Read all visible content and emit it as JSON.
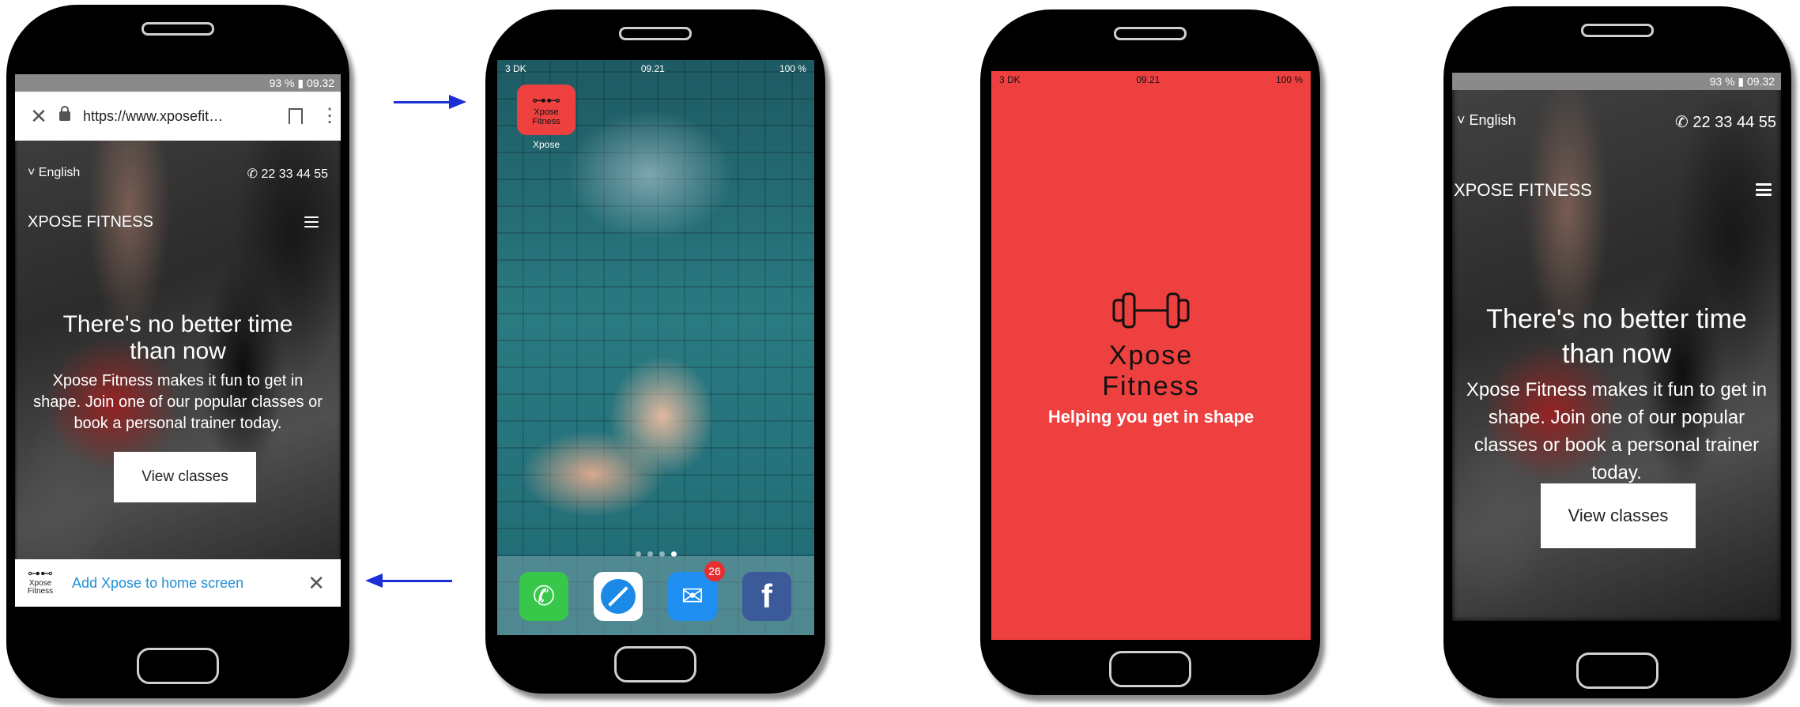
{
  "phone1": {
    "status": "93 % ▮ 09.32",
    "url": "https://www.xposefit…",
    "language": "English",
    "phone": "22 33 44 55",
    "brand": "XPOSE FITNESS",
    "headline": "There's no better time than now",
    "subtext": "Xpose Fitness makes it fun to get in shape. Join one of our popular classes or book a personal trainer today.",
    "cta": "View classes",
    "install_text": "Add Xpose to home screen",
    "install_logo": "Xpose Fitness"
  },
  "phone2": {
    "carrier": "3 DK",
    "time": "09.21",
    "battery": "100 %",
    "app_label": "Xpose",
    "app_icon_text": "Xpose Fitness",
    "mail_badge": "26",
    "page_count": 4
  },
  "phone3": {
    "carrier": "3 DK",
    "time": "09.21",
    "battery": "100 %",
    "logo_line1": "Xpose",
    "logo_line2": "Fitness",
    "tagline": "Helping you get in shape",
    "splash_color": "#ef4040"
  },
  "phone4": {
    "status": "93 % ▮ 09.32",
    "language": "English",
    "phone": "22 33 44 55",
    "brand": "XPOSE FITNESS",
    "headline": "There's no better time than now",
    "subtext": "Xpose Fitness makes it fun to get in shape. Join one of our popular classes or book a personal trainer today.",
    "cta": "View classes"
  },
  "colors": {
    "accent_red": "#ef4040",
    "arrow_blue": "#1a2fd6",
    "link_blue": "#1e8fd6"
  },
  "icons": [
    "close-icon",
    "lock-icon",
    "bookmark-icon",
    "more-icon",
    "chevron-down-icon",
    "phone-icon",
    "menu-icon",
    "dumbbell-icon",
    "phone-app-icon",
    "safari-icon",
    "mail-icon",
    "facebook-icon"
  ]
}
